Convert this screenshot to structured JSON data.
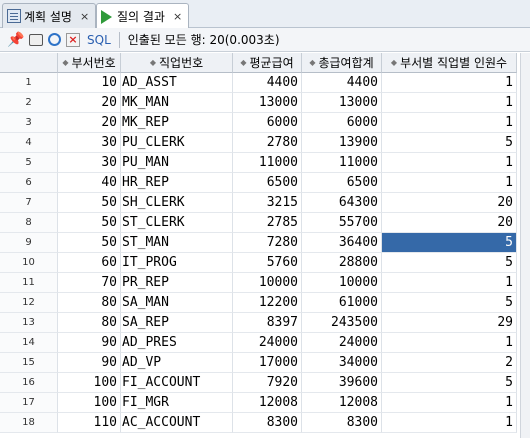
{
  "tabs": [
    {
      "label": "계획 설명",
      "icon": "explain-plan-icon"
    },
    {
      "label": "질의 결과",
      "icon": "run-query-icon"
    }
  ],
  "tab_close": "×",
  "toolbar": {
    "sql_label": "SQL",
    "status": "인출된 모든 행: 20(0.003초)"
  },
  "columns": [
    "",
    "부서번호",
    "직업번호",
    "평균급여",
    "총급여합계",
    "부서별 직업별 인원수"
  ],
  "rows": [
    {
      "rn": "1",
      "dept": "10",
      "job": "AD_ASST",
      "avg": "4400",
      "sum": "4400",
      "cnt": "1"
    },
    {
      "rn": "2",
      "dept": "20",
      "job": "MK_MAN",
      "avg": "13000",
      "sum": "13000",
      "cnt": "1"
    },
    {
      "rn": "3",
      "dept": "20",
      "job": "MK_REP",
      "avg": "6000",
      "sum": "6000",
      "cnt": "1"
    },
    {
      "rn": "4",
      "dept": "30",
      "job": "PU_CLERK",
      "avg": "2780",
      "sum": "13900",
      "cnt": "5"
    },
    {
      "rn": "5",
      "dept": "30",
      "job": "PU_MAN",
      "avg": "11000",
      "sum": "11000",
      "cnt": "1"
    },
    {
      "rn": "6",
      "dept": "40",
      "job": "HR_REP",
      "avg": "6500",
      "sum": "6500",
      "cnt": "1"
    },
    {
      "rn": "7",
      "dept": "50",
      "job": "SH_CLERK",
      "avg": "3215",
      "sum": "64300",
      "cnt": "20"
    },
    {
      "rn": "8",
      "dept": "50",
      "job": "ST_CLERK",
      "avg": "2785",
      "sum": "55700",
      "cnt": "20"
    },
    {
      "rn": "9",
      "dept": "50",
      "job": "ST_MAN",
      "avg": "7280",
      "sum": "36400",
      "cnt": "5"
    },
    {
      "rn": "10",
      "dept": "60",
      "job": "IT_PROG",
      "avg": "5760",
      "sum": "28800",
      "cnt": "5"
    },
    {
      "rn": "11",
      "dept": "70",
      "job": "PR_REP",
      "avg": "10000",
      "sum": "10000",
      "cnt": "1"
    },
    {
      "rn": "12",
      "dept": "80",
      "job": "SA_MAN",
      "avg": "12200",
      "sum": "61000",
      "cnt": "5"
    },
    {
      "rn": "13",
      "dept": "80",
      "job": "SA_REP",
      "avg": "8397",
      "sum": "243500",
      "cnt": "29"
    },
    {
      "rn": "14",
      "dept": "90",
      "job": "AD_PRES",
      "avg": "24000",
      "sum": "24000",
      "cnt": "1"
    },
    {
      "rn": "15",
      "dept": "90",
      "job": "AD_VP",
      "avg": "17000",
      "sum": "34000",
      "cnt": "2"
    },
    {
      "rn": "16",
      "dept": "100",
      "job": "FI_ACCOUNT",
      "avg": "7920",
      "sum": "39600",
      "cnt": "5"
    },
    {
      "rn": "17",
      "dept": "100",
      "job": "FI_MGR",
      "avg": "12008",
      "sum": "12008",
      "cnt": "1"
    },
    {
      "rn": "18",
      "dept": "110",
      "job": "AC_ACCOUNT",
      "avg": "8300",
      "sum": "8300",
      "cnt": "1"
    }
  ],
  "selected": {
    "row": 8,
    "column": "cnt"
  },
  "colors": {
    "selection": "#3569a8",
    "run_icon": "#2f9a3a"
  }
}
